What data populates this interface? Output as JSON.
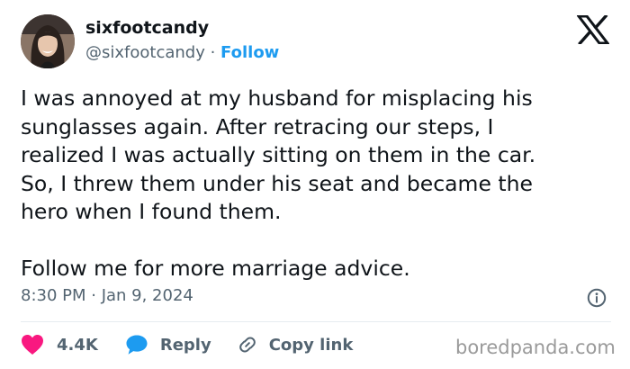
{
  "author": {
    "display_name": "sixfootcandy",
    "handle": "@sixfootcandy",
    "separator": " · ",
    "follow_label": "Follow"
  },
  "tweet": {
    "text": "I was annoyed at my husband for misplacing his\nsunglasses again. After retracing our steps, I\nrealized I was actually sitting on them in the car.\nSo, I threw them under his seat and became the\nhero when I found them.\n\nFollow me for more marriage advice.",
    "timestamp": "8:30 PM · Jan 9, 2024"
  },
  "actions": {
    "like_count": "4.4K",
    "reply_label": "Reply",
    "copy_label": "Copy link"
  },
  "watermark": "boredpanda.com",
  "icons": {
    "brand": "x-logo-icon",
    "like": "heart-icon",
    "reply": "speech-bubble-icon",
    "copy": "link-icon",
    "info": "info-icon"
  },
  "colors": {
    "text": "#0f1419",
    "muted": "#536471",
    "accent": "#1d9bf0",
    "like": "#f91880",
    "reply": "#1d9bf0"
  }
}
